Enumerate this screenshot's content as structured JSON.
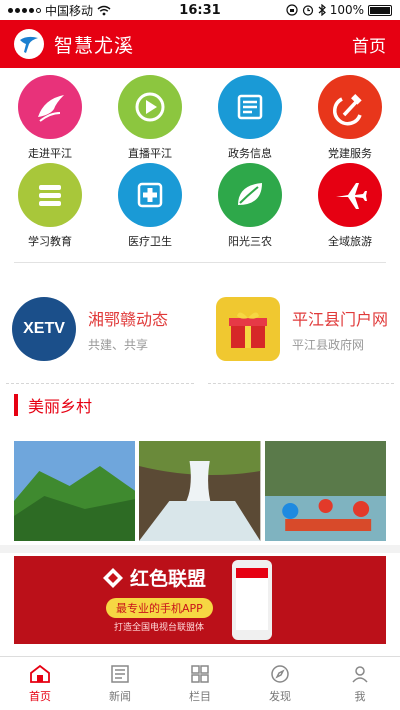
{
  "status_bar": {
    "carrier": "中国移动",
    "time": "16:31",
    "battery": "100%"
  },
  "header": {
    "title": "智慧尤溪",
    "home_label": "首页"
  },
  "grid": [
    {
      "label": "走进平江",
      "icon": "feather-icon",
      "color": "#e8327a"
    },
    {
      "label": "直播平江",
      "icon": "play-icon",
      "color": "#8cc63f"
    },
    {
      "label": "政务信息",
      "icon": "document-icon",
      "color": "#1a9ad6"
    },
    {
      "label": "党建服务",
      "icon": "hammer-sickle-icon",
      "color": "#f39200"
    },
    {
      "label": "学习教育",
      "icon": "books-icon",
      "color": "#a8c73a"
    },
    {
      "label": "医疗卫生",
      "icon": "medical-cross-icon",
      "color": "#1a9ad6"
    },
    {
      "label": "阳光三农",
      "icon": "leaf-icon",
      "color": "#2ea84a"
    },
    {
      "label": "全域旅游",
      "icon": "airplane-icon",
      "color": "#e60012"
    }
  ],
  "promos": [
    {
      "logo_text": "XETV",
      "title": "湘鄂赣动态",
      "subtitle": "共建、共享"
    },
    {
      "logo_text": "",
      "title": "平江县门户网",
      "subtitle": "平江县政府网"
    }
  ],
  "section": {
    "title": "美丽乡村"
  },
  "banner": {
    "title": "红色联盟",
    "pill": "最专业的手机APP",
    "tagline": "打造全国电视台联盟体"
  },
  "tabbar": [
    {
      "label": "首页",
      "icon": "home-icon",
      "active": true
    },
    {
      "label": "新闻",
      "icon": "news-icon",
      "active": false
    },
    {
      "label": "栏目",
      "icon": "grid-icon",
      "active": false
    },
    {
      "label": "发现",
      "icon": "compass-icon",
      "active": false
    },
    {
      "label": "我",
      "icon": "user-icon",
      "active": false
    }
  ],
  "colors": {
    "brand": "#e60012",
    "muted": "#999999"
  }
}
